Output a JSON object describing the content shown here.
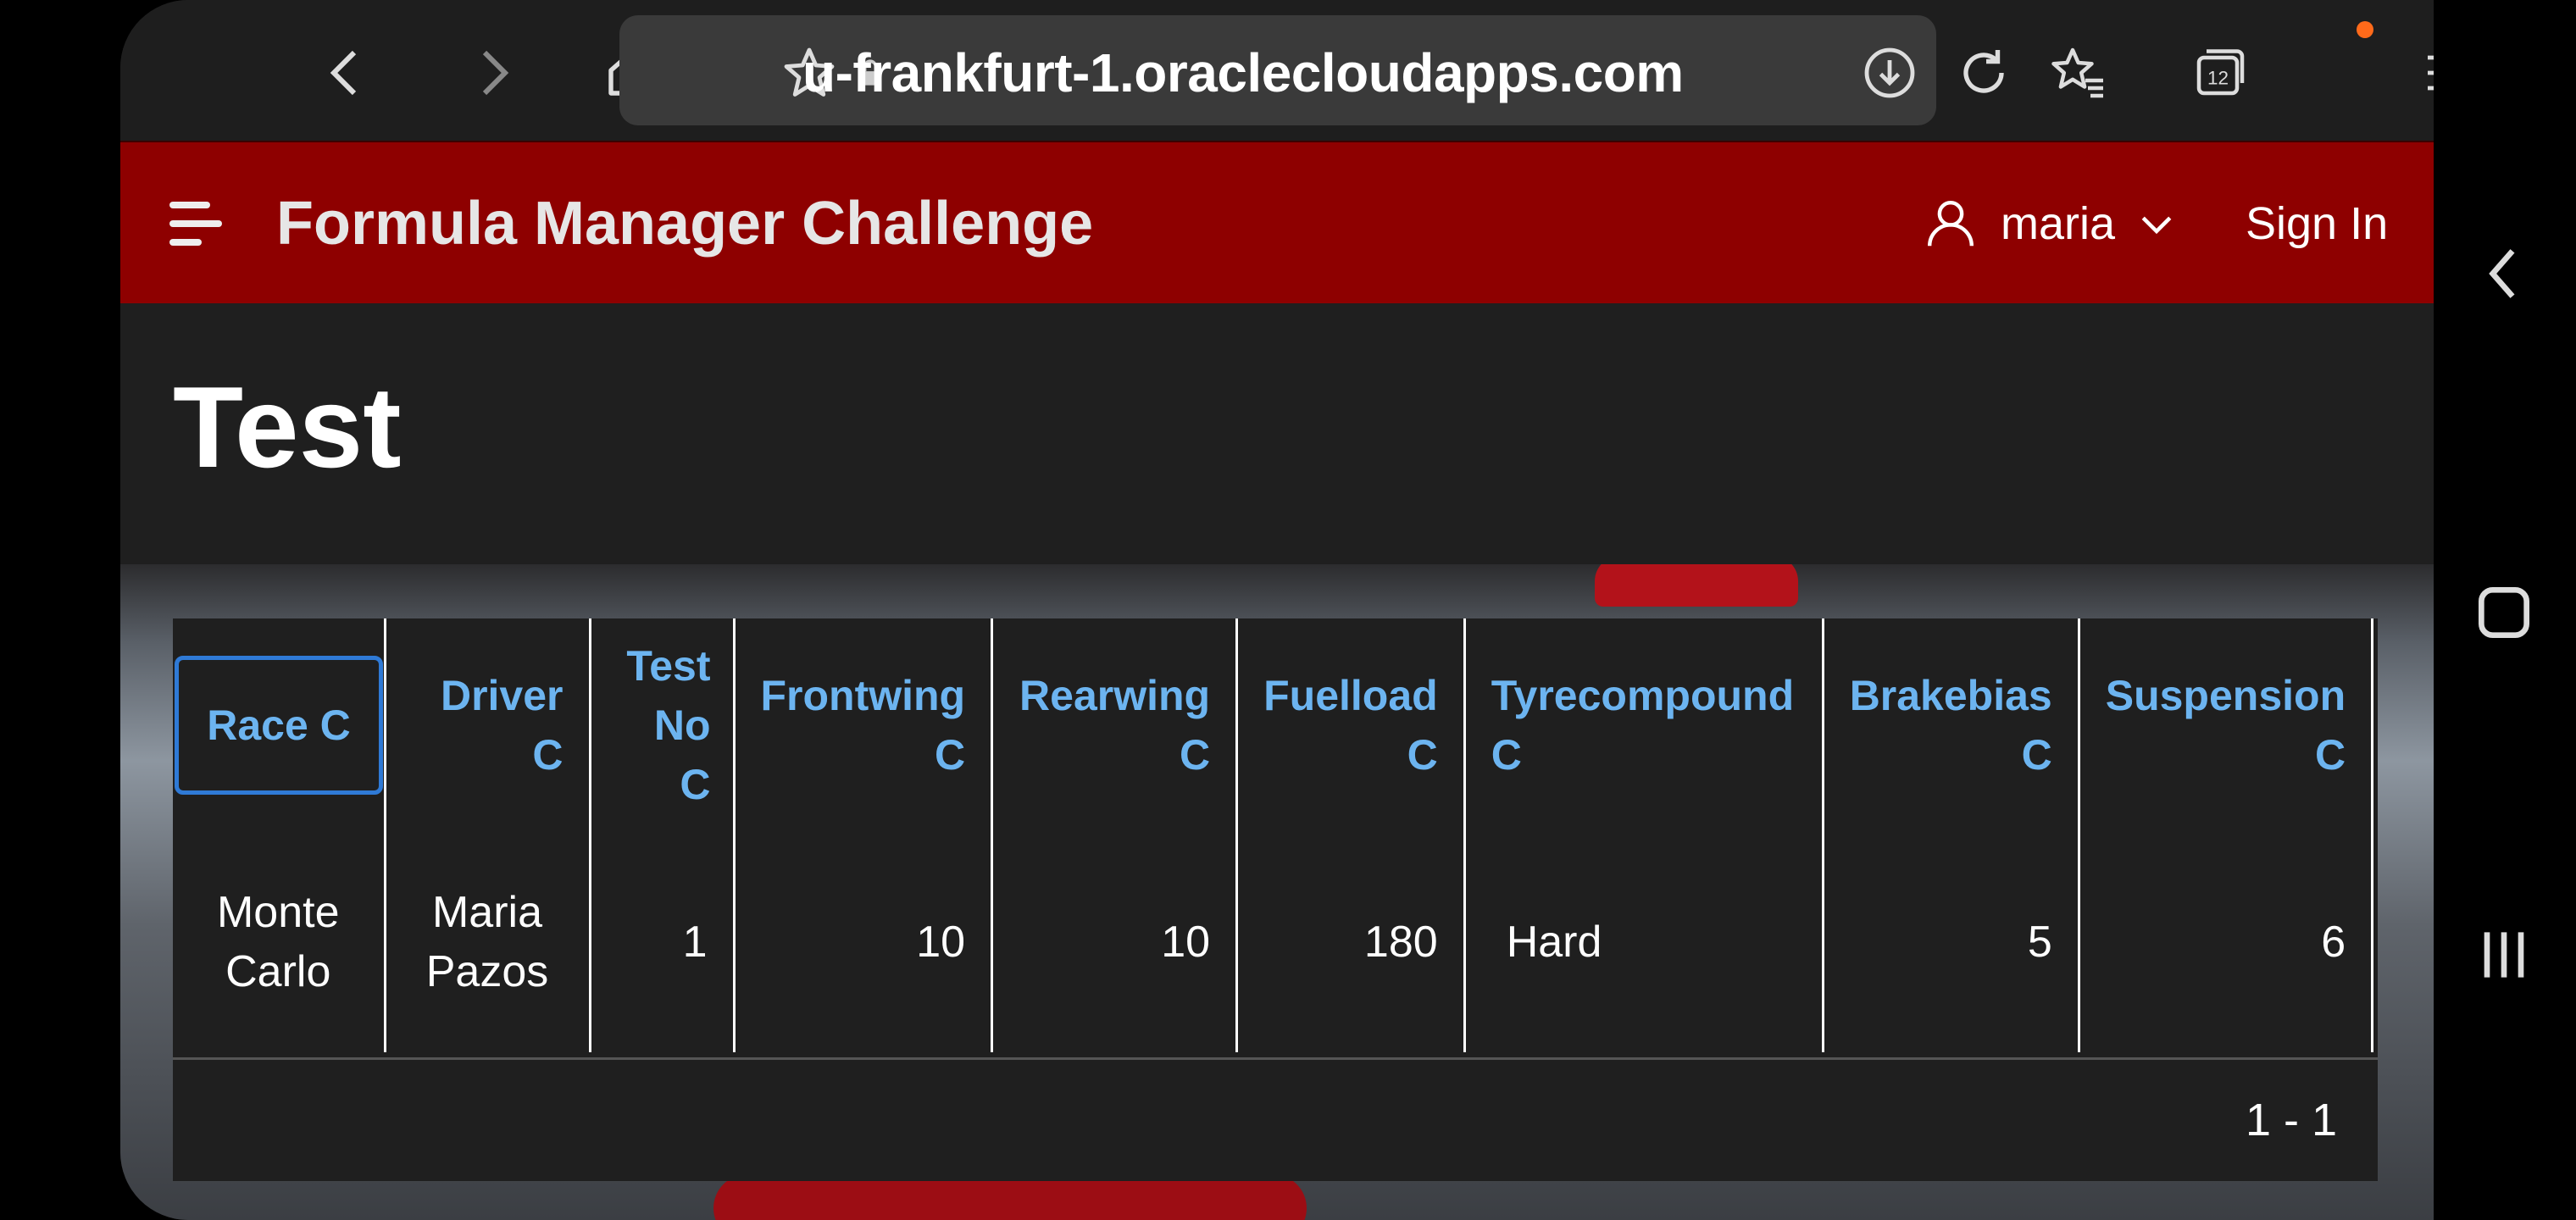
{
  "browser": {
    "url": "u-frankfurt-1.oraclecloudapps.com",
    "tab_count": "12"
  },
  "app": {
    "title": "Formula Manager Challenge",
    "user": "maria",
    "sign_in": "Sign In"
  },
  "page": {
    "title": "Test"
  },
  "report": {
    "columns": [
      "Race C",
      "Driver C",
      "Test No C",
      "Frontwing C",
      "Rearwing C",
      "Fuelload C",
      "Tyrecompound C",
      "Brakebias C",
      "Suspension C"
    ],
    "rows": [
      [
        "Monte Carlo",
        "Maria Pazos",
        "1",
        "10",
        "10",
        "180",
        "Hard",
        "5",
        "6"
      ]
    ],
    "pagination": "1 - 1"
  },
  "colors": {
    "header_bg": "#8e0000",
    "column_header_text": "#6cb4f0",
    "page_bg": "#1f1f1f",
    "focus_ring": "#2f7ad6"
  }
}
